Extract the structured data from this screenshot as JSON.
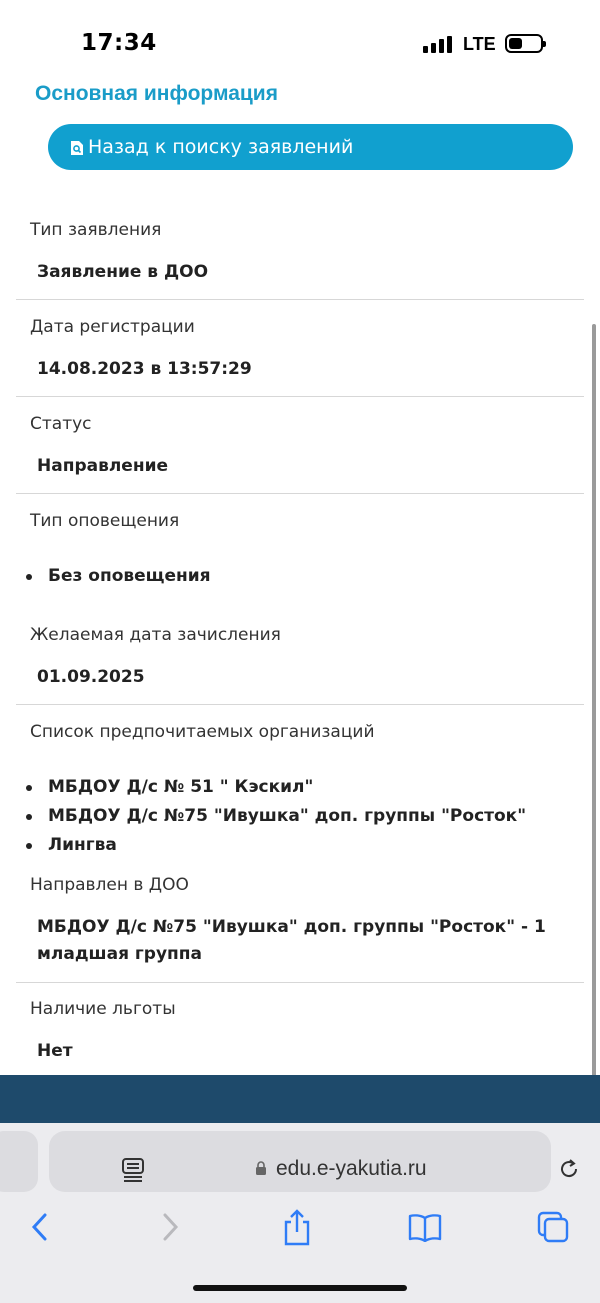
{
  "status_bar": {
    "time": "17:34",
    "network": "LTE"
  },
  "header": {
    "title": "Основная информация",
    "back_button_label": "Назад к поиску заявлений"
  },
  "fields": {
    "type": {
      "label": "Тип заявления",
      "value": "Заявление в ДОО"
    },
    "reg_date": {
      "label": "Дата регистрации",
      "value": "14.08.2023 в 13:57:29"
    },
    "status": {
      "label": "Статус",
      "value": "Направление"
    },
    "notify": {
      "label": "Тип оповещения",
      "items": [
        "Без оповещения"
      ]
    },
    "enroll_date": {
      "label": "Желаемая дата зачисления",
      "value": "01.09.2025"
    },
    "orgs": {
      "label": "Список предпочитаемых организаций",
      "items": [
        "МБДОУ Д/с № 51 \" Кэскил\"",
        "МБДОУ Д/с №75 \"Ивушка\" доп. группы \"Росток\"",
        "Лингва"
      ]
    },
    "directed": {
      "label": "Направлен в ДОО",
      "value_line1": "МБДОУ Д/с №75 \"Ивушка\" доп. группы \"Росток\" - 1",
      "value_line2": "младшая группа"
    },
    "benefit": {
      "label": "Наличие льготы",
      "value": "Нет"
    }
  },
  "browser": {
    "url": "edu.e-yakutia.ru"
  },
  "colors": {
    "accent": "#11a0cf",
    "title": "#1a9cc8",
    "footer": "#1e4a6b",
    "ios_blue": "#2f7cf6"
  },
  "icons": [
    "search-doc-icon",
    "reader-icon",
    "lock-icon",
    "reload-icon",
    "back-arrow-icon",
    "forward-arrow-icon",
    "share-icon",
    "bookmarks-icon",
    "tabs-icon"
  ]
}
